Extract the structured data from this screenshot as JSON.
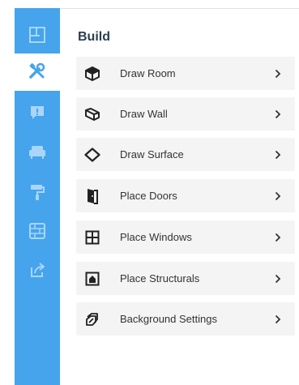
{
  "sidebar": {
    "items": [
      {
        "icon": "floorplan-icon",
        "active": false
      },
      {
        "icon": "build-tools-icon",
        "active": true
      },
      {
        "icon": "notes-icon",
        "active": false
      },
      {
        "icon": "furniture-icon",
        "active": false
      },
      {
        "icon": "paint-roller-icon",
        "active": false
      },
      {
        "icon": "materials-icon",
        "active": false
      },
      {
        "icon": "share-icon",
        "active": false
      }
    ]
  },
  "panel": {
    "title": "Build",
    "items": [
      {
        "label": "Draw Room",
        "icon": "room-cube-icon"
      },
      {
        "label": "Draw Wall",
        "icon": "wall-icon"
      },
      {
        "label": "Draw Surface",
        "icon": "surface-icon"
      },
      {
        "label": "Place Doors",
        "icon": "door-icon"
      },
      {
        "label": "Place Windows",
        "icon": "window-icon"
      },
      {
        "label": "Place Structurals",
        "icon": "structural-icon"
      },
      {
        "label": "Background Settings",
        "icon": "background-settings-icon"
      }
    ]
  },
  "colors": {
    "sidebar": "#45a4ec",
    "active_icon": "#45a4ec",
    "inactive_icon": "#8dcaf7",
    "menu_bg": "#f4f4f4",
    "text": "#333333"
  }
}
